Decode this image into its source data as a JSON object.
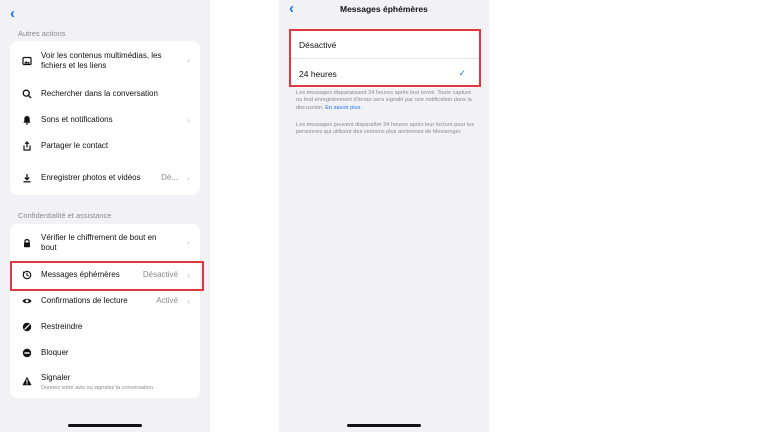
{
  "left": {
    "back_icon": "chevron-left-icon",
    "section1": {
      "label": "Autres actions",
      "items": [
        {
          "icon": "image-icon",
          "label": "Voir les contenus multimédias, les fichiers et les liens",
          "value": ""
        },
        {
          "icon": "search-icon",
          "label": "Rechercher dans la conversation",
          "value": ""
        },
        {
          "icon": "bell-icon",
          "label": "Sons et notifications",
          "value": ""
        },
        {
          "icon": "share-icon",
          "label": "Partager le contact",
          "value": ""
        },
        {
          "icon": "download-icon",
          "label": "Enregistrer photos et vidéos",
          "value": "Dé..."
        }
      ]
    },
    "section2": {
      "label": "Confidentialité et assistance",
      "items": [
        {
          "icon": "lock-icon",
          "label": "Vérifier le chiffrement de bout en bout",
          "value": ""
        },
        {
          "icon": "timer-icon",
          "label": "Messages éphémères",
          "value": "Désactivé"
        },
        {
          "icon": "eye-icon",
          "label": "Confirmations de lecture",
          "value": "Activé"
        },
        {
          "icon": "restrict-icon",
          "label": "Restreindre",
          "value": ""
        },
        {
          "icon": "block-icon",
          "label": "Bloquer",
          "value": ""
        },
        {
          "icon": "warning-icon",
          "label": "Signaler",
          "value": "",
          "sub": "Donnez votre avis ou signalez la conversation"
        }
      ]
    }
  },
  "right": {
    "title": "Messages éphémères",
    "options": [
      {
        "label": "Désactivé",
        "selected": false
      },
      {
        "label": "24 heures",
        "selected": true
      }
    ],
    "info1": "Les messages disparaissent 24 heures après leur envoi. Toute capture ou tout enregistrement d'écran sera signalé par une notification dans la discussion.",
    "info1_link": "En savoir plus",
    "info2": "Les messages peuvent disparaître 24 heures après leur lecture pour les personnes qui utilisent des versions plus anciennes de Messenger."
  },
  "colors": {
    "accent": "#1a73e8",
    "highlight": "#e0383e",
    "background": "#f2f2f6"
  }
}
